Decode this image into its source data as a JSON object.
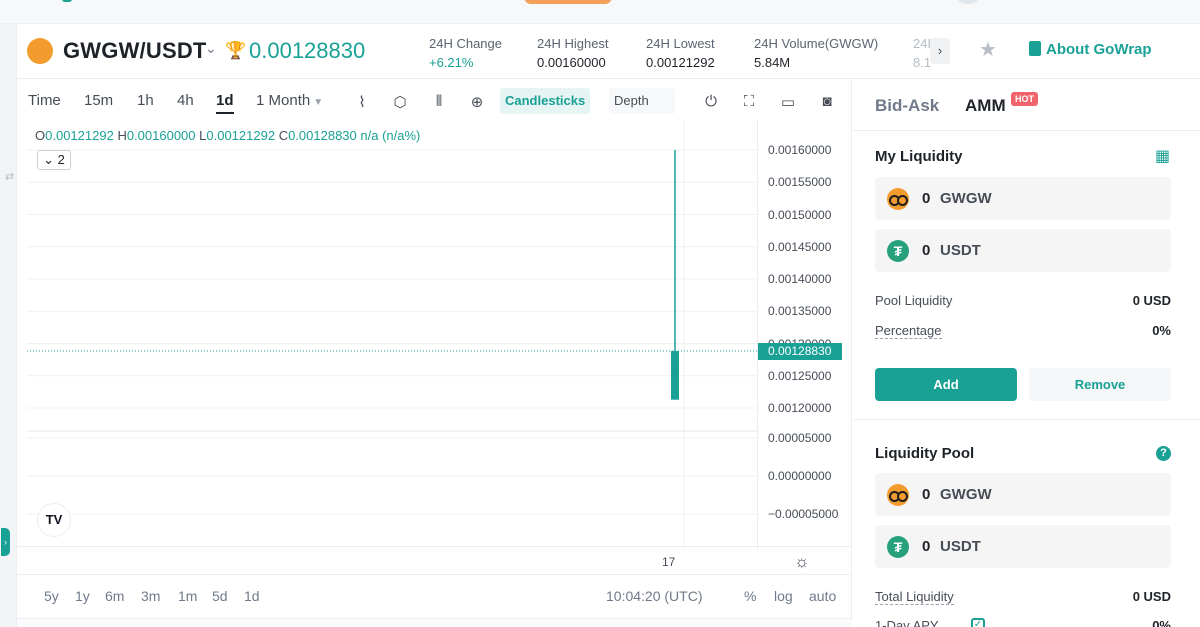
{
  "ticker": {
    "pair": "GWGW/USDT",
    "price": "0.00128830",
    "stats": [
      {
        "label": "24H Change",
        "value": "+6.21%"
      },
      {
        "label": "24H Highest",
        "value": "0.00160000"
      },
      {
        "label": "24H Lowest",
        "value": "0.00121292"
      },
      {
        "label": "24H Volume(GWGW)",
        "value": "5.84M"
      },
      {
        "label": "24H",
        "value": "8.1"
      }
    ],
    "about_label": "About GoWrap"
  },
  "toolbar": {
    "intervals": [
      "Time",
      "15m",
      "1h",
      "4h",
      "1d",
      "1 Month"
    ],
    "active_interval": "1d",
    "view_candlesticks": "Candlesticks",
    "view_depth": "Depth"
  },
  "chart": {
    "ohlc": {
      "o_label": "O",
      "o": "0.00121292",
      "h_label": "H",
      "h": "0.00160000",
      "l_label": "L",
      "l": "0.00121292",
      "c_label": "C",
      "c": "0.00128830",
      "extra": "n/a (n/a%)"
    },
    "layers_count": "2",
    "timestamp": "10:04:20 (UTC)",
    "percent_label": "%",
    "log_label": "log",
    "auto_label": "auto",
    "ranges": [
      "5y",
      "1y",
      "6m",
      "3m",
      "1m",
      "5d",
      "1d"
    ],
    "tv_logo": "TV"
  },
  "chart_data": {
    "type": "candlestick",
    "x_tick_labels": [
      "17"
    ],
    "y_tick_labels": [
      "0.00160000",
      "0.00155000",
      "0.00150000",
      "0.00145000",
      "0.00140000",
      "0.00135000",
      "0.00130000",
      "0.00125000",
      "0.00120000",
      "0.00005000",
      "0.00000000",
      "−0.00005000"
    ],
    "current_price_label": "0.00128830",
    "candles": [
      {
        "x": "17",
        "open": 0.00121292,
        "high": 0.0016,
        "low": 0.00121292,
        "close": 0.0012883
      }
    ],
    "volume_pane": {
      "ylim": [
        -5e-05,
        5e-05
      ]
    },
    "colors": {
      "up": "#1aa195",
      "grid": "#f0f1f3"
    }
  },
  "panel": {
    "tab_bidask": "Bid-Ask",
    "tab_amm": "AMM",
    "hot_badge": "HOT",
    "my_liquidity": {
      "title": "My Liquidity",
      "assets": [
        {
          "amount": "0",
          "symbol": "GWGW"
        },
        {
          "amount": "0",
          "symbol": "USDT"
        }
      ],
      "pool_liquidity_label": "Pool Liquidity",
      "pool_liquidity_value": "0 USD",
      "percentage_label": "Percentage",
      "percentage_value": "0%",
      "add_label": "Add",
      "remove_label": "Remove"
    },
    "liquidity_pool": {
      "title": "Liquidity Pool",
      "assets": [
        {
          "amount": "0",
          "symbol": "GWGW"
        },
        {
          "amount": "0",
          "symbol": "USDT"
        }
      ],
      "total_liquidity_label": "Total Liquidity",
      "total_liquidity_value": "0 USD",
      "apy_label": "1-Day APY",
      "apy_value": "0%"
    }
  },
  "theme": {
    "accent": "#1aa195",
    "hot": "#f0656c",
    "brand_coin": "#f29b2e"
  }
}
